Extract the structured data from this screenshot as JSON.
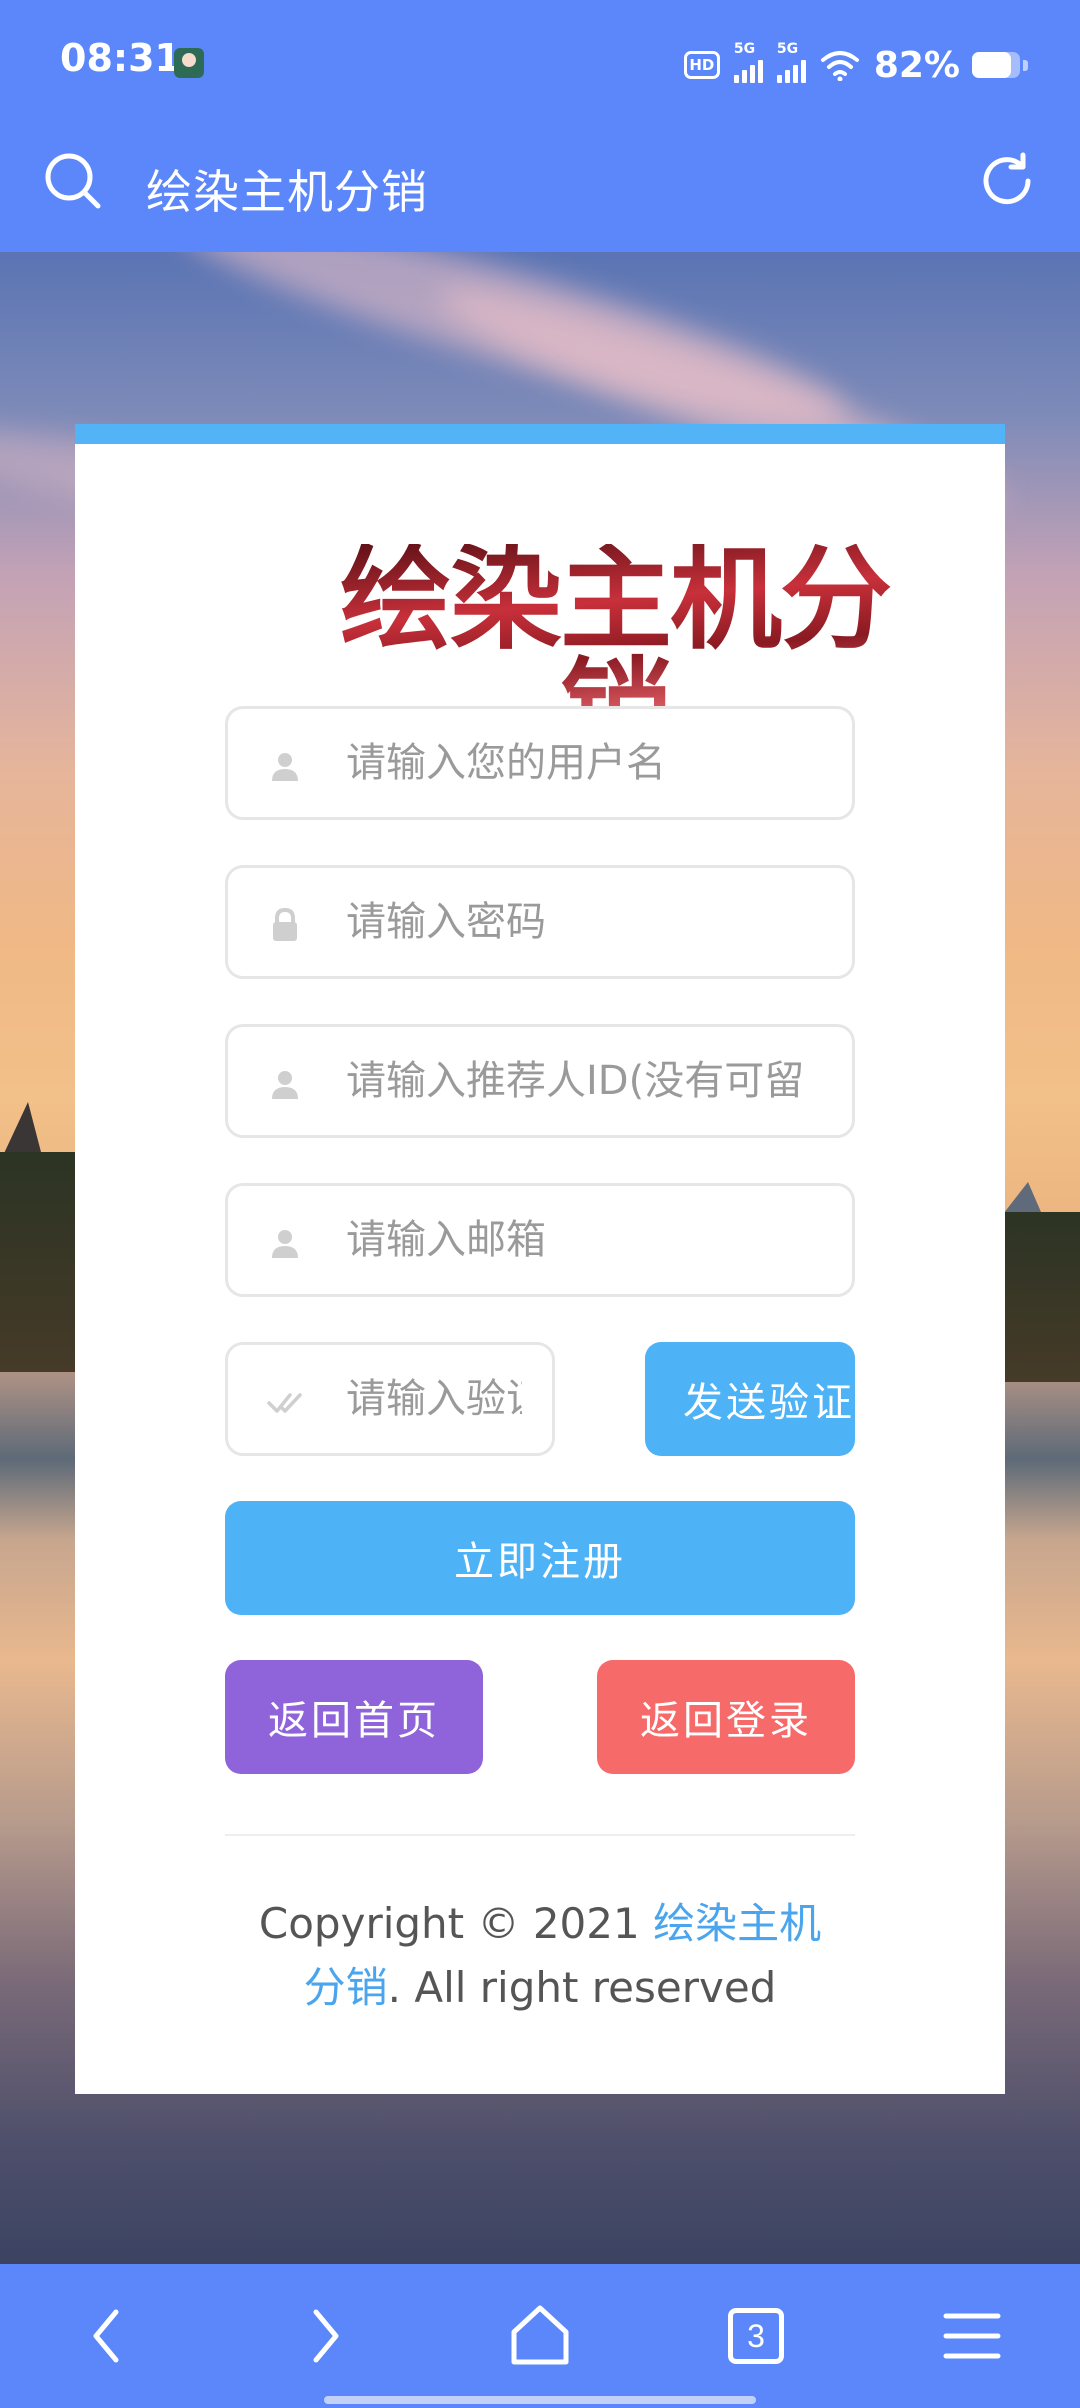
{
  "status": {
    "time": "08:31",
    "hd": "HD",
    "net1": "5G",
    "net2": "5G",
    "battery_text": "82%",
    "battery_level": 0.82
  },
  "browser": {
    "title": "绘染主机分销",
    "tab_count": "3"
  },
  "form": {
    "logo": "绘染主机分销",
    "username_placeholder": "请输入您的用户名",
    "password_placeholder": "请输入密码",
    "referrer_placeholder": "请输入推荐人ID(没有可留",
    "email_placeholder": "请输入邮箱",
    "code_placeholder": "请输入验证码",
    "send_code_label": "发送验证码",
    "register_label": "立即注册",
    "home_label": "返回首页",
    "login_label": "返回登录"
  },
  "footer": {
    "copyright_prefix": "Copyright © 2021 ",
    "site_link_1": "绘染主机",
    "site_link_2": "分销",
    "copyright_suffix": ". All right reserved"
  },
  "colors": {
    "theme_blue": "#5b87fb",
    "accent_blue": "#4db2f6",
    "purple": "#8f63d9",
    "red": "#f76a6a",
    "link": "#4aa5ee"
  },
  "icons": [
    "search-icon",
    "refresh-icon",
    "user-icon",
    "lock-icon",
    "check-icon",
    "back-icon",
    "forward-icon",
    "home-icon",
    "tabs-icon",
    "menu-icon"
  ]
}
